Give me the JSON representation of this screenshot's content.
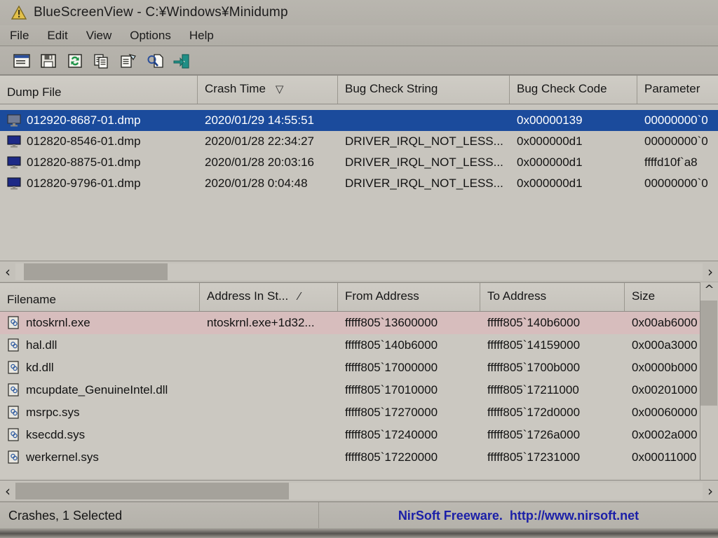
{
  "window": {
    "title": "BlueScreenView  -  C:¥Windows¥Minidump",
    "warning_icon": "warning-triangle-icon"
  },
  "menu": {
    "items": [
      {
        "label": "File"
      },
      {
        "label": "Edit"
      },
      {
        "label": "View"
      },
      {
        "label": "Options"
      },
      {
        "label": "Help"
      }
    ]
  },
  "toolbar": {
    "buttons": [
      {
        "icon": "properties-window-icon",
        "name": "properties"
      },
      {
        "icon": "save-floppy-icon",
        "name": "save"
      },
      {
        "icon": "refresh-icon",
        "name": "refresh"
      },
      {
        "icon": "copy-icon",
        "name": "copy"
      },
      {
        "icon": "html-report-icon",
        "name": "html-report"
      },
      {
        "icon": "find-magnifier-icon",
        "name": "find"
      },
      {
        "icon": "exit-door-icon",
        "name": "exit"
      }
    ]
  },
  "crash_list": {
    "columns": [
      {
        "label": "Dump File",
        "sort": ""
      },
      {
        "label": "Crash Time",
        "sort": "▽"
      },
      {
        "label": "Bug Check String",
        "sort": ""
      },
      {
        "label": "Bug Check Code",
        "sort": ""
      },
      {
        "label": "Parameter",
        "sort": ""
      }
    ],
    "rows": [
      {
        "dump_file": "012920-8687-01.dmp",
        "crash_time": "2020/01/29 14:55:51",
        "bug_check_string": "",
        "bug_check_code": "0x00000139",
        "parameter": "00000000`0",
        "selected": true
      },
      {
        "dump_file": "012820-8546-01.dmp",
        "crash_time": "2020/01/28 22:34:27",
        "bug_check_string": "DRIVER_IRQL_NOT_LESS...",
        "bug_check_code": "0x000000d1",
        "parameter": "00000000`0",
        "selected": false
      },
      {
        "dump_file": "012820-8875-01.dmp",
        "crash_time": "2020/01/28 20:03:16",
        "bug_check_string": "DRIVER_IRQL_NOT_LESS...",
        "bug_check_code": "0x000000d1",
        "parameter": "ffffd10f`a8",
        "selected": false
      },
      {
        "dump_file": "012820-9796-01.dmp",
        "crash_time": "2020/01/28 0:04:48",
        "bug_check_string": "DRIVER_IRQL_NOT_LESS...",
        "bug_check_code": "0x000000d1",
        "parameter": "00000000`0",
        "selected": false
      }
    ],
    "scroll": {
      "left_arrow": "‹",
      "right_arrow": "›"
    }
  },
  "driver_list": {
    "columns": [
      {
        "label": "Filename",
        "sort": ""
      },
      {
        "label": "Address In St...",
        "sort": "⁄"
      },
      {
        "label": "From Address",
        "sort": ""
      },
      {
        "label": "To Address",
        "sort": ""
      },
      {
        "label": "Size",
        "sort": ""
      }
    ],
    "rows": [
      {
        "filename": "ntoskrnl.exe",
        "address_in_stack": "ntoskrnl.exe+1d32...",
        "from_address": "fffff805`13600000",
        "to_address": "fffff805`140b6000",
        "size": "0x00ab6000",
        "highlighted": true
      },
      {
        "filename": "hal.dll",
        "address_in_stack": "",
        "from_address": "fffff805`140b6000",
        "to_address": "fffff805`14159000",
        "size": "0x000a3000",
        "highlighted": false
      },
      {
        "filename": "kd.dll",
        "address_in_stack": "",
        "from_address": "fffff805`17000000",
        "to_address": "fffff805`1700b000",
        "size": "0x0000b000",
        "highlighted": false
      },
      {
        "filename": "mcupdate_GenuineIntel.dll",
        "address_in_stack": "",
        "from_address": "fffff805`17010000",
        "to_address": "fffff805`17211000",
        "size": "0x00201000",
        "highlighted": false
      },
      {
        "filename": "msrpc.sys",
        "address_in_stack": "",
        "from_address": "fffff805`17270000",
        "to_address": "fffff805`172d0000",
        "size": "0x00060000",
        "highlighted": false
      },
      {
        "filename": "ksecdd.sys",
        "address_in_stack": "",
        "from_address": "fffff805`17240000",
        "to_address": "fffff805`1726a000",
        "size": "0x0002a000",
        "highlighted": false
      },
      {
        "filename": "werkernel.sys",
        "address_in_stack": "",
        "from_address": "fffff805`17220000",
        "to_address": "fffff805`17231000",
        "size": "0x00011000",
        "highlighted": false
      }
    ],
    "scroll": {
      "left_arrow": "‹",
      "right_arrow": "›",
      "up_arrow": "^"
    }
  },
  "status": {
    "left": "Crashes, 1 Selected",
    "brand": "NirSoft Freeware.",
    "url": "http://www.nirsoft.net"
  },
  "colors": {
    "selection_blue": "#1b4b9c",
    "highlight_pink": "#d7bdbd",
    "link_blue": "#1b1fa8",
    "chrome_gray": "#b3b0a9"
  }
}
